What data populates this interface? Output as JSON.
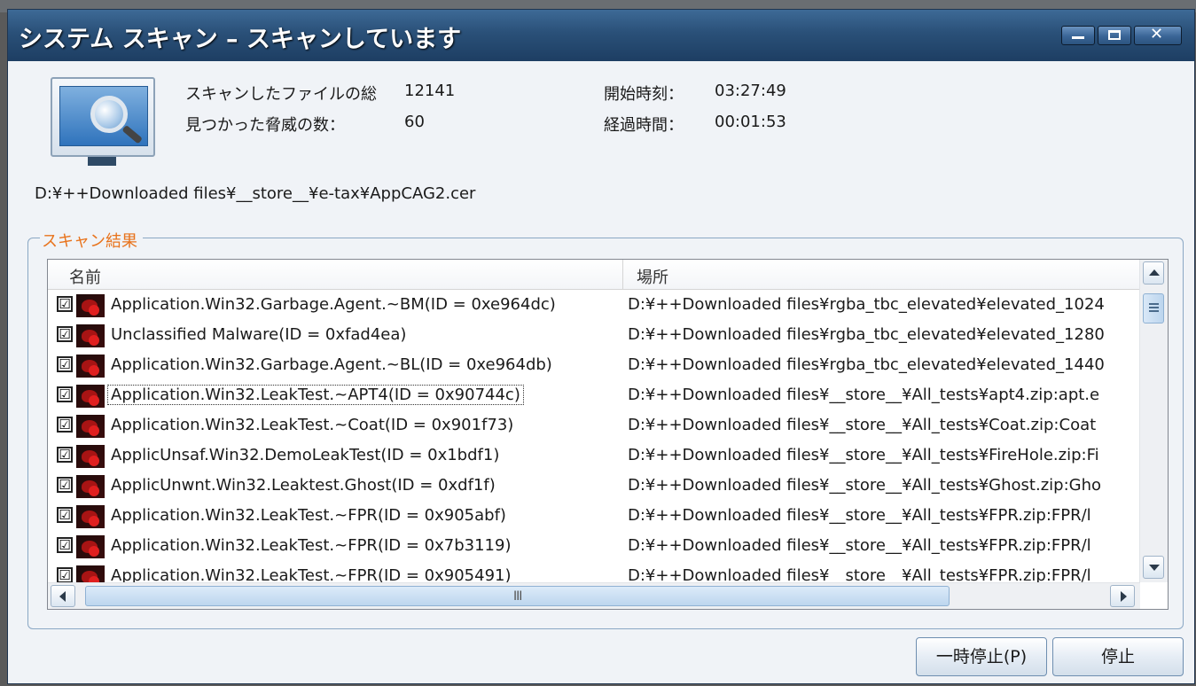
{
  "window": {
    "title": "システム スキャン – スキャンしています",
    "minimize_glyph": "",
    "close_glyph": "✕"
  },
  "stats": {
    "scanned_label": "スキャンしたファイルの総",
    "scanned_value": "12141",
    "threats_label": "見つかった脅威の数：",
    "threats_value": "60",
    "start_label": "開始時刻：",
    "start_value": "03:27:49",
    "elapsed_label": "経過時間：",
    "elapsed_value": "00:01:53"
  },
  "current_path": "D:¥++Downloaded files¥__store__¥e-tax¥AppCAG2.cer",
  "results": {
    "group_label": "スキャン結果",
    "columns": {
      "name": "名前",
      "location": "場所"
    },
    "rows": [
      {
        "name": "Application.Win32.Garbage.Agent.~BM(ID = 0xe964dc)",
        "location": "D:¥++Downloaded files¥rgba_tbc_elevated¥elevated_1024",
        "checked": "☑"
      },
      {
        "name": "Unclassified Malware(ID = 0xfad4ea)",
        "location": "D:¥++Downloaded files¥rgba_tbc_elevated¥elevated_1280",
        "checked": "☑"
      },
      {
        "name": "Application.Win32.Garbage.Agent.~BL(ID = 0xe964db)",
        "location": "D:¥++Downloaded files¥rgba_tbc_elevated¥elevated_1440",
        "checked": "☑"
      },
      {
        "name": "Application.Win32.LeakTest.~APT4(ID = 0x90744c)",
        "location": "D:¥++Downloaded files¥__store__¥All_tests¥apt4.zip:apt.e",
        "checked": "☑"
      },
      {
        "name": "Application.Win32.LeakTest.~Coat(ID = 0x901f73)",
        "location": "D:¥++Downloaded files¥__store__¥All_tests¥Coat.zip:Coat",
        "checked": "☑"
      },
      {
        "name": "ApplicUnsaf.Win32.DemoLeakTest(ID = 0x1bdf1)",
        "location": "D:¥++Downloaded files¥__store__¥All_tests¥FireHole.zip:Fi",
        "checked": "☑"
      },
      {
        "name": "ApplicUnwnt.Win32.Leaktest.Ghost(ID = 0xdf1f)",
        "location": "D:¥++Downloaded files¥__store__¥All_tests¥Ghost.zip:Gho",
        "checked": "☑"
      },
      {
        "name": "Application.Win32.LeakTest.~FPR(ID = 0x905abf)",
        "location": "D:¥++Downloaded files¥__store__¥All_tests¥FPR.zip:FPR/l",
        "checked": "☑"
      },
      {
        "name": "Application.Win32.LeakTest.~FPR(ID = 0x7b3119)",
        "location": "D:¥++Downloaded files¥__store__¥All_tests¥FPR.zip:FPR/l",
        "checked": "☑"
      },
      {
        "name": "Application.Win32.LeakTest.~FPR(ID = 0x905491)",
        "location": "D:¥++Downloaded files¥__store__¥All_tests¥FPR.zip:FPR/l",
        "checked": "☑"
      }
    ],
    "scroll_grip": "III"
  },
  "buttons": {
    "pause": "一時停止(P)",
    "stop": "停止"
  },
  "icons": {
    "monitor": "scan-monitor-icon",
    "threat": "threat-icon"
  },
  "colors": {
    "title_bar": "#2a5078",
    "group_label": "#e8731c"
  }
}
